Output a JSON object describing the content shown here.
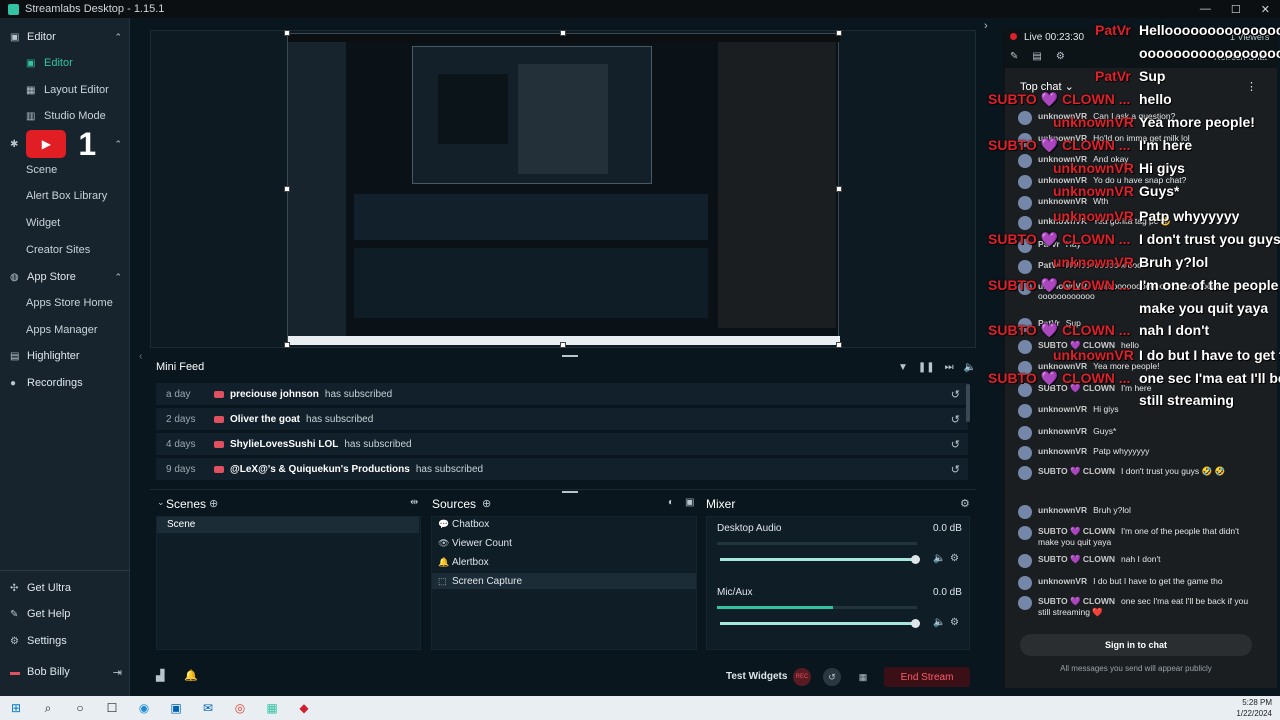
{
  "window": {
    "title": "Streamlabs Desktop - 1.15.1",
    "min": "—",
    "max": "☐",
    "close": "✕"
  },
  "sidebar": {
    "editor_section": "Editor",
    "editor_items": [
      {
        "label": "Editor"
      },
      {
        "label": "Layout Editor"
      },
      {
        "label": "Studio Mode"
      }
    ],
    "themes_items": [
      {
        "label": "Scene"
      },
      {
        "label": "Alert Box Library"
      },
      {
        "label": "Widget"
      },
      {
        "label": "Creator Sites"
      }
    ],
    "app_store": "App Store",
    "app_items": [
      {
        "label": "Apps Store Home"
      },
      {
        "label": "Apps Manager"
      }
    ],
    "highlighter": "Highlighter",
    "recordings": "Recordings",
    "bottom": [
      {
        "label": "Get Ultra"
      },
      {
        "label": "Get Help"
      },
      {
        "label": "Settings"
      }
    ],
    "user": "Bob Billy",
    "overlay_number": "1"
  },
  "minifeed": {
    "title": "Mini Feed",
    "rows": [
      {
        "time": "a day",
        "name": "preciouse johnson",
        "action": "has subscribed"
      },
      {
        "time": "2 days",
        "name": "Oliver the goat",
        "action": "has subscribed"
      },
      {
        "time": "4 days",
        "name": "ShylieLovesSushi LOL",
        "action": "has subscribed"
      },
      {
        "time": "9 days",
        "name": "@LeX@'s & Quiquekun's Productions",
        "action": "has subscribed"
      }
    ]
  },
  "scenes": {
    "title": "Scenes",
    "items": [
      "Scene"
    ]
  },
  "sources": {
    "title": "Sources",
    "items": [
      {
        "label": "Chatbox",
        "icon": "chat-icon"
      },
      {
        "label": "Viewer Count",
        "icon": "eye-icon"
      },
      {
        "label": "Alertbox",
        "icon": "bell-icon"
      },
      {
        "label": "Screen Capture",
        "icon": "screen-icon"
      }
    ]
  },
  "mixer": {
    "title": "Mixer",
    "channels": [
      {
        "label": "Desktop Audio",
        "db": "0.0 dB",
        "level": 0.0
      },
      {
        "label": "Mic/Aux",
        "db": "0.0 dB",
        "level": 0.58
      }
    ]
  },
  "footer": {
    "test_widgets": "Test Widgets",
    "end_stream": "End Stream",
    "rec_label": "REC"
  },
  "live": {
    "status": "Live 00:23:30",
    "viewers": "1 Viewers",
    "refresh": "Refresh Chat"
  },
  "chat": {
    "header": "Top chat",
    "signin": "Sign in to chat",
    "footer_note": "All messages you send will appear publicly",
    "messages": [
      {
        "user": "unknownVR",
        "msg": "Can I ask a question?"
      },
      {
        "user": "unknownVR",
        "msg": "Ho'ld on imma get milk lol"
      },
      {
        "user": "unknownVR",
        "msg": "And okay"
      },
      {
        "user": "unknownVR",
        "msg": "Yo do u have snap chat?"
      },
      {
        "user": "unknownVR",
        "msg": "Wth"
      },
      {
        "user": "unknownVR",
        "msg": "Yea gorilla tag pc 😅"
      },
      {
        "user": "PatVr",
        "msg": "Hay"
      },
      {
        "user": "PatVr",
        "msg": "Helloooooooooooooo"
      },
      {
        "user": "unknownVR",
        "msg": "Helloooooooooooooooooooooooo oooooooooooo"
      },
      {
        "user": "PatVr",
        "msg": "Sup"
      },
      {
        "user": "SUBTO 💜 CLOWN",
        "msg": "hello"
      },
      {
        "user": "unknownVR",
        "msg": "Yea more people!"
      },
      {
        "user": "SUBTO 💜 CLOWN",
        "msg": "I'm here"
      },
      {
        "user": "unknownVR",
        "msg": "Hi giys"
      },
      {
        "user": "unknownVR",
        "msg": "Guys*"
      },
      {
        "user": "unknownVR",
        "msg": "Patp whyyyyyy"
      },
      {
        "user": "SUBTO 💜 CLOWN",
        "msg": "I don't trust you guys 🤣 🤣"
      },
      {
        "user": "unknownVR",
        "msg": "Bruh y?lol"
      },
      {
        "user": "SUBTO 💜 CLOWN",
        "msg": "I'm one of the people that didn't make you quit yaya"
      },
      {
        "user": "SUBTO 💜 CLOWN",
        "msg": "nah I don't"
      },
      {
        "user": "unknownVR",
        "msg": "I do but I have to get the game tho"
      },
      {
        "user": "SUBTO 💜 CLOWN",
        "msg": "one sec I'ma eat I'll be back if you still streaming ❤️"
      }
    ]
  },
  "overlay": {
    "lines": [
      {
        "who": "PatVr",
        "text": "Helloooooooooooooooo"
      },
      {
        "who": "",
        "text": "oooooooooooooooooooo"
      },
      {
        "who": "PatVr",
        "text": "Sup"
      },
      {
        "who": "SUBTO 💜 CLOWN ...",
        "text": "hello"
      },
      {
        "who": "unknownVR",
        "text": "Yea more people!"
      },
      {
        "who": "SUBTO 💜 CLOWN ...",
        "text": "I'm here"
      },
      {
        "who": "unknownVR",
        "text": "Hi giys"
      },
      {
        "who": "unknownVR",
        "text": "Guys*"
      },
      {
        "who": "unknownVR",
        "text": "Patp whyyyyyy"
      },
      {
        "who": "SUBTO 💜 CLOWN ...",
        "text": "I don't trust you guys"
      },
      {
        "who": "unknownVR",
        "text": "Bruh y?lol"
      },
      {
        "who": "SUBTO 💜 CLOWN ...",
        "text": "I'm one of the people"
      },
      {
        "who": "",
        "text": "make you quit yaya"
      },
      {
        "who": "SUBTO 💜 CLOWN ...",
        "text": "nah I don't"
      },
      {
        "who": "unknownVR",
        "text": "I do but I have to get t"
      },
      {
        "who": "SUBTO 💜 CLOWN ...",
        "text": "one sec I'ma eat I'll be"
      },
      {
        "who": "",
        "text": "still streaming"
      }
    ]
  },
  "taskbar": {
    "time": "5:28 PM",
    "date": "1/22/2024"
  },
  "colors": {
    "accent": "#31c3a2",
    "live_red": "#e0202a",
    "end_stream": "#ff5a66"
  }
}
